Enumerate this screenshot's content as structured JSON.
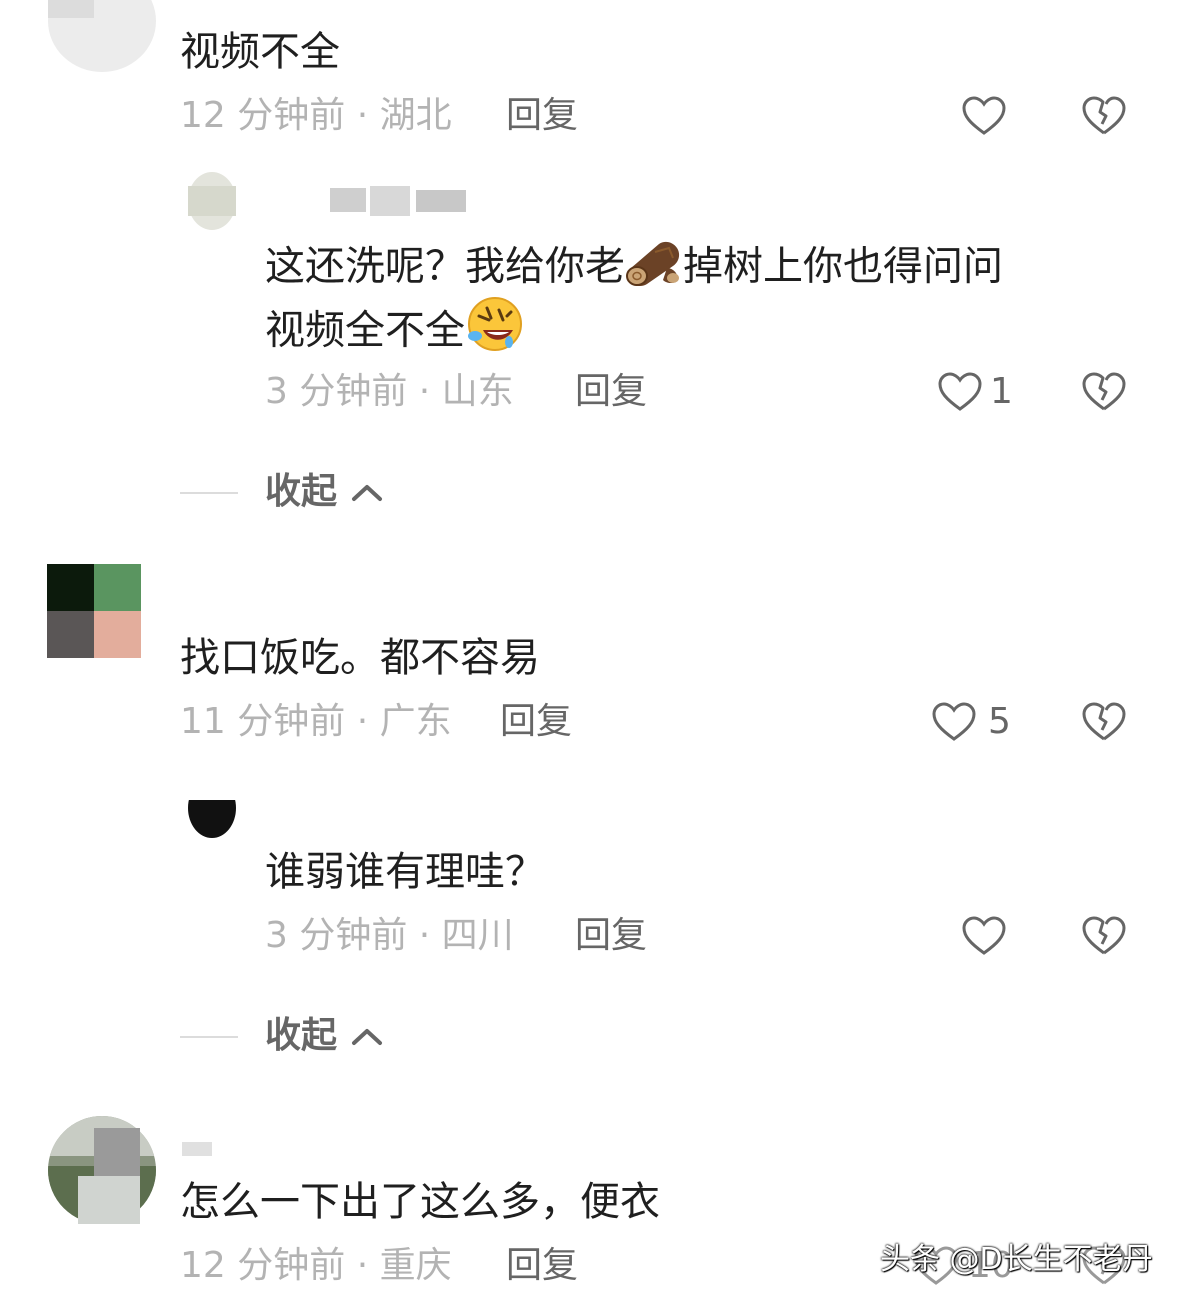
{
  "comments": [
    {
      "text": "视频不全",
      "time_location": "12 分钟前 · 湖北",
      "reply_label": "回复"
    },
    {
      "username_partial": "",
      "text_line1": "这还洗呢？我给你老",
      "text_line1b": "掉树上你也得问问",
      "text_line2": "视频全不全",
      "time_location": "3 分钟前 · 山东",
      "reply_label": "回复",
      "like_count": "1"
    },
    {
      "collapse_label": "收起"
    },
    {
      "text": "找口饭吃。都不容易",
      "time_location": "11 分钟前 · 广东",
      "reply_label": "回复",
      "like_count": "5"
    },
    {
      "text": "谁弱谁有理哇？",
      "time_location": "3 分钟前 · 四川",
      "reply_label": "回复"
    },
    {
      "collapse_label": "收起"
    },
    {
      "text": "怎么一下出了这么多，便衣",
      "time_location": "12 分钟前 · 重庆",
      "reply_label": "回复",
      "like_count": "10"
    }
  ],
  "watermark": "头条 @D长生不老丹",
  "icons": {
    "like": "heart-outline-icon",
    "dislike": "broken-heart-icon",
    "chevron": "chevron-up-icon",
    "log_emoji": "wood-log-emoji",
    "laugh_emoji": "rofl-emoji"
  }
}
